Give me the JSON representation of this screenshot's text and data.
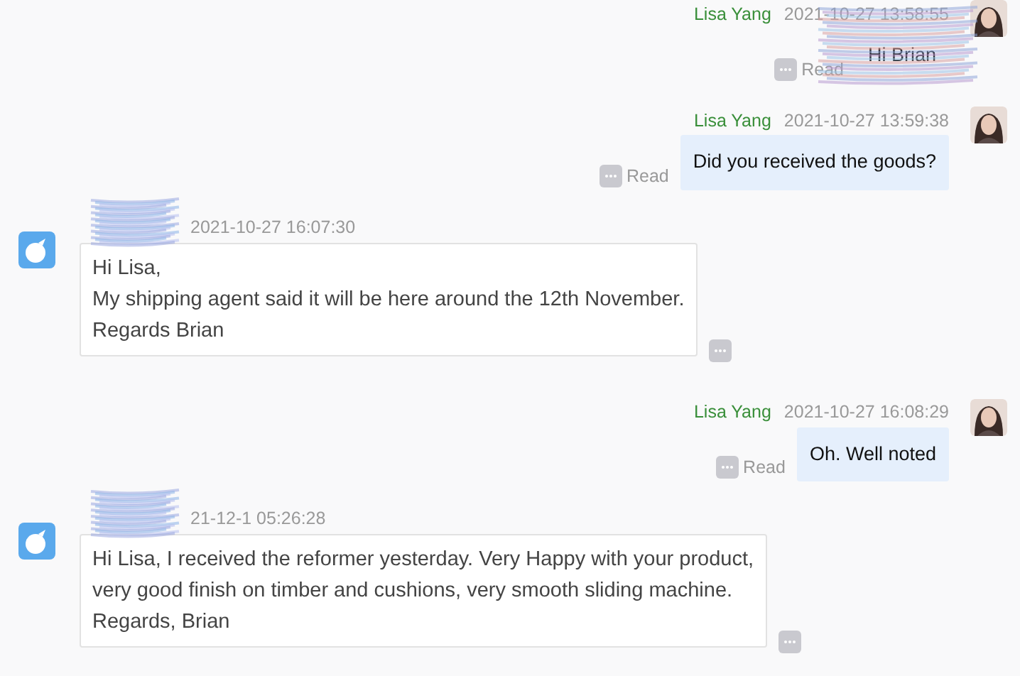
{
  "messages": [
    {
      "kind": "outgoing",
      "sender": "Lisa Yang",
      "time": "2021-10-27 13:58:55",
      "text": "Hi Brian",
      "status": "Read",
      "redacted": true
    },
    {
      "kind": "outgoing",
      "sender": "Lisa Yang",
      "time": "2021-10-27 13:59:38",
      "text": "Did you received the goods?",
      "status": "Read",
      "redacted": false
    },
    {
      "kind": "incoming",
      "time": "2021-10-27 16:07:30",
      "text": "Hi Lisa,\nMy shipping agent said it will be here around the 12th November.\nRegards Brian",
      "redacted": true
    },
    {
      "kind": "outgoing",
      "sender": "Lisa Yang",
      "time": "2021-10-27 16:08:29",
      "text": "Oh. Well noted",
      "status": "Read",
      "redacted": false
    },
    {
      "kind": "incoming",
      "time": "21-12-1 05:26:28",
      "text": "Hi Lisa, I received the reformer yesterday. Very Happy with your product,\nvery good finish on timber and cushions, very smooth sliding machine.\nRegards, Brian",
      "redacted": true
    }
  ]
}
